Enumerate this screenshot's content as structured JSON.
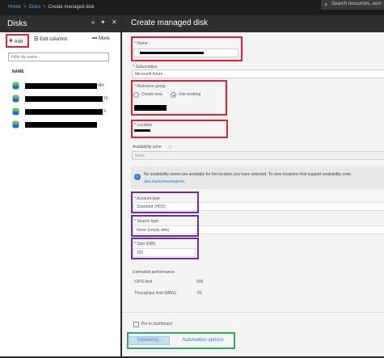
{
  "breadcrumb": {
    "home": "Home",
    "disks": "Disks",
    "current": "Create managed disk"
  },
  "search": {
    "placeholder": "Search resources, serv"
  },
  "left_panel": {
    "title": "Disks",
    "toolbar": {
      "add": "Add",
      "edit_columns": "Edit columns",
      "more": "More"
    },
    "filter_placeholder": "Filter by name...",
    "column_name": "NAME",
    "rows": [
      {
        "tail": "4fd-"
      },
      {
        "tail": "15-"
      },
      {
        "tail": "2-"
      },
      {
        "tail": ""
      }
    ]
  },
  "right_panel": {
    "title": "Create managed disk",
    "name_label": "* Name",
    "subscription_label": "* Subscription",
    "subscription_value": "Microsoft Azure",
    "resource_group_label": "* Resource group",
    "rg_create_new": "Create new",
    "rg_use_existing": "Use existing",
    "location_label": "* Location",
    "availability_zone_label": "Availability zone",
    "availability_zone_value": "None",
    "info_text_1": "No availability zones are available for the location you have selected. To view locations that support availability zone",
    "info_text_2": "aka.ms/azonesregions.",
    "account_type_label": "* Account type",
    "account_type_value": "Standard (HDD)",
    "source_type_label": "* Source type",
    "source_type_value": "None (empty disk)",
    "size_label": "* Size (GiB)",
    "size_value": "255",
    "est_perf_label": "Estimated performance",
    "iops_label": "IOPS limit",
    "iops_value": "500",
    "throughput_label": "Throughput limit (MB/s)",
    "throughput_value": "60",
    "pin_label": "Pin to dashboard",
    "validating_label": "Validating...",
    "automation_label": "Automation options"
  }
}
